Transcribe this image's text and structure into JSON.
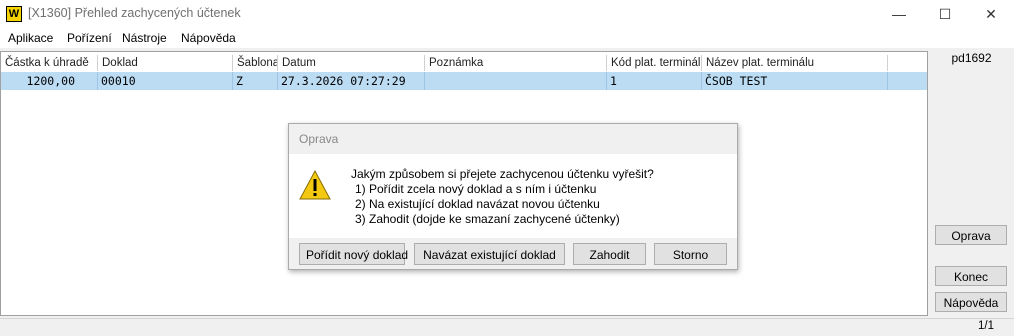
{
  "window": {
    "title": "[X1360] Přehled zachycených účtenek",
    "app_icon_glyph": "W",
    "minimize_glyph": "—",
    "maximize_glyph": "☐",
    "close_glyph": "✕"
  },
  "menu": [
    "Aplikace",
    "Pořízení",
    "Nástroje",
    "Nápověda"
  ],
  "grid": {
    "columns": [
      "Částka k úhradě",
      "Doklad",
      "Šablona",
      "Datum",
      "Poznámka",
      "Kód plat. terminálu",
      "Název plat. terminálu"
    ],
    "rows": [
      [
        "1200,00",
        "00010",
        "Z",
        "27.3.2026 07:27:29",
        "",
        "1",
        "ČSOB TEST"
      ]
    ]
  },
  "right_panel": {
    "user": "pd1692",
    "oprava_label": "Oprava",
    "konec_label": "Konec",
    "napoveda_label": "Nápověda"
  },
  "dialog": {
    "title": "Oprava",
    "icon": "warning-icon",
    "lines": [
      "Jakým způsobem si přejete zachycenou účtenku vyřešit?",
      "1) Pořídit zcela nový doklad a s ním i účtenku",
      "2) Na existující doklad navázat novou účtenku",
      "3) Zahodit (dojde ke smazaní zachycené účtenky)"
    ],
    "buttons": {
      "new_doc": "Pořídit nový doklad",
      "link_existing": "Navázat existující doklad",
      "discard": "Zahodit",
      "cancel": "Storno"
    }
  },
  "status": {
    "page": "1/1"
  },
  "colors": {
    "selection": "#bcdcf4",
    "warning": "#f2c811"
  }
}
